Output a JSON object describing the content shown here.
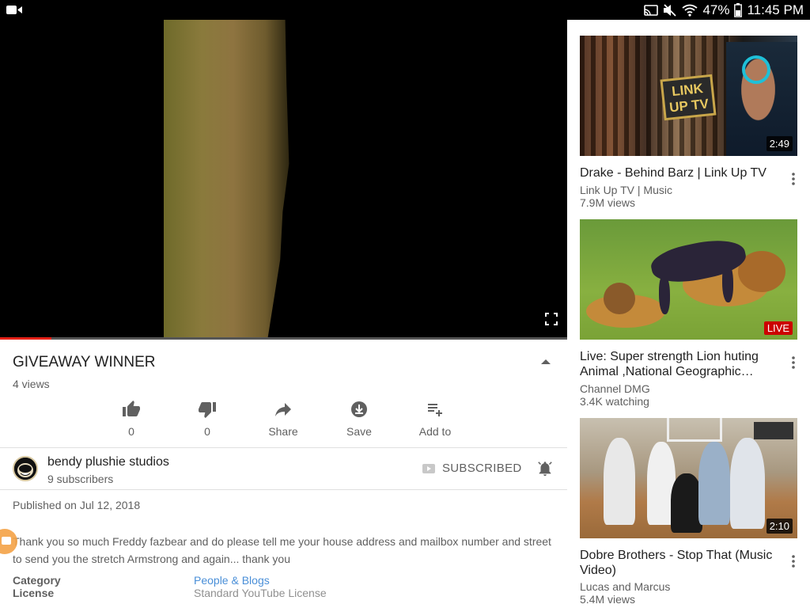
{
  "status_bar": {
    "battery": "47%",
    "time": "11:45 PM"
  },
  "player": {
    "progress": 0.09
  },
  "video": {
    "title": "GIVEAWAY WINNER",
    "views": "4 views",
    "actions": [
      {
        "name": "like",
        "label": "0",
        "icon": "thumb-up-icon"
      },
      {
        "name": "dislike",
        "label": "0",
        "icon": "thumb-down-icon"
      },
      {
        "name": "share",
        "label": "Share",
        "icon": "share-icon"
      },
      {
        "name": "save",
        "label": "Save",
        "icon": "download-icon"
      },
      {
        "name": "add-to",
        "label": "Add to",
        "icon": "playlist-add-icon"
      }
    ]
  },
  "channel": {
    "name": "bendy plushie studios",
    "subscribers": "9 subscribers",
    "subscribe_label": "SUBSCRIBED"
  },
  "details": {
    "published": "Published on Jul 12, 2018",
    "description": "Thank you so much Freddy fazbear and do please tell me your house address and mailbox number and street to send you the stretch Armstrong and again... thank you",
    "category_key": "Category",
    "category_value": "People & Blogs",
    "license_key": "License",
    "license_value": "Standard YouTube License"
  },
  "recommendations": [
    {
      "title": "Drake - Behind Barz | Link Up TV",
      "channel": "Link Up TV | Music",
      "meta": "7.9M views",
      "duration": "2:49",
      "thumb_text": "LINK UP TV"
    },
    {
      "title": "Live: Super strength  Lion huting Animal ,National Geographic…",
      "channel": "Channel DMG",
      "meta": "3.4K watching",
      "badge": "LIVE"
    },
    {
      "title": "Dobre Brothers - Stop That (Music Video)",
      "channel": "Lucas and Marcus",
      "meta": "5.4M views",
      "duration": "2:10"
    }
  ]
}
